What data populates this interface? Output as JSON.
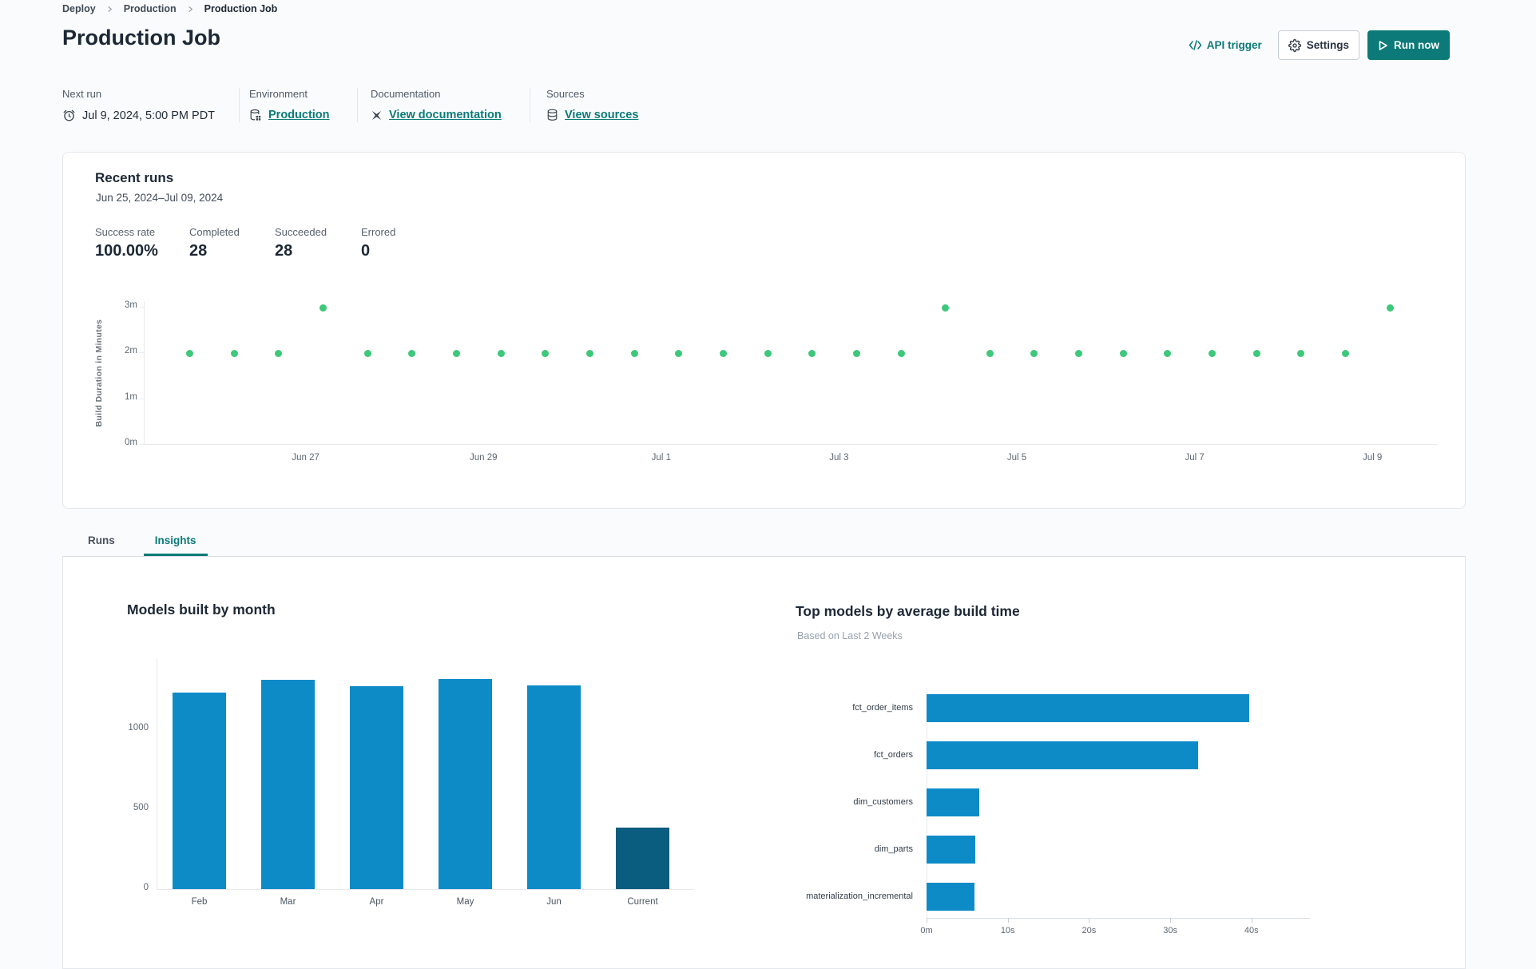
{
  "breadcrumb": {
    "items": [
      {
        "label": "Deploy"
      },
      {
        "label": "Production"
      },
      {
        "label": "Production Job"
      }
    ]
  },
  "header": {
    "title": "Production Job",
    "actions": {
      "api_trigger": "API trigger",
      "settings": "Settings",
      "run_now": "Run now"
    }
  },
  "meta": {
    "next_run": {
      "label": "Next run",
      "value": "Jul 9, 2024, 5:00 PM PDT"
    },
    "environment": {
      "label": "Environment",
      "value": "Production"
    },
    "documentation": {
      "label": "Documentation",
      "value": "View documentation"
    },
    "sources": {
      "label": "Sources",
      "value": "View sources"
    }
  },
  "recent_runs": {
    "title": "Recent runs",
    "date_range": "Jun 25, 2024–Jul 09, 2024",
    "stats": [
      {
        "label": "Success rate",
        "value": "100.00%"
      },
      {
        "label": "Completed",
        "value": "28"
      },
      {
        "label": "Succeeded",
        "value": "28"
      },
      {
        "label": "Errored",
        "value": "0"
      }
    ]
  },
  "tabs": [
    {
      "label": "Runs",
      "active": false
    },
    {
      "label": "Insights",
      "active": true
    }
  ],
  "colors": {
    "accent_teal": "#0b7a78",
    "scatter_green": "#3dc87a",
    "bar_blue": "#0d8bc7",
    "bar_dark_blue": "#0a5d7e"
  },
  "chart_data": [
    {
      "type": "scatter",
      "name": "build-duration-by-run",
      "ylabel": "Build Duration in Minutes",
      "point_color": "#3dc87a",
      "yticks": [
        {
          "label": "0m",
          "minutes": 0
        },
        {
          "label": "1m",
          "minutes": 1
        },
        {
          "label": "2m",
          "minutes": 2
        },
        {
          "label": "3m",
          "minutes": 3
        }
      ],
      "xticks": [
        {
          "label": "Jun 27",
          "frac": 0.1251
        },
        {
          "label": "Jun 29",
          "frac": 0.2625
        },
        {
          "label": "Jul 1",
          "frac": 0.3999
        },
        {
          "label": "Jul 3",
          "frac": 0.5373
        },
        {
          "label": "Jul 5",
          "frac": 0.6747
        },
        {
          "label": "Jul 7",
          "frac": 0.8121
        },
        {
          "label": "Jul 9",
          "frac": 0.9495
        }
      ],
      "point_start_frac": 0.0356,
      "point_step_frac": 0.03435,
      "points_minutes": [
        1.97,
        1.97,
        1.97,
        2.97,
        1.97,
        1.97,
        1.97,
        1.97,
        1.97,
        1.97,
        1.97,
        1.97,
        1.97,
        1.97,
        1.97,
        1.97,
        1.97,
        2.97,
        1.97,
        1.97,
        1.97,
        1.97,
        1.97,
        1.97,
        1.97,
        1.97,
        1.97,
        2.97
      ],
      "ylim_minutes": [
        0,
        3.1
      ]
    },
    {
      "type": "bar",
      "title": "Models built by month",
      "categories": [
        "Feb",
        "Mar",
        "Apr",
        "May",
        "Jun",
        "Current"
      ],
      "values": [
        1230,
        1310,
        1270,
        1315,
        1275,
        385
      ],
      "yticks": [
        0,
        500,
        1000
      ],
      "ylim": [
        0,
        1440
      ],
      "bar_colors": [
        "#0d8bc7",
        "#0d8bc7",
        "#0d8bc7",
        "#0d8bc7",
        "#0d8bc7",
        "#0a5d7e"
      ]
    },
    {
      "type": "hbar",
      "title": "Top models by average build time",
      "subtitle": "Based on Last 2 Weeks",
      "categories": [
        "fct_order_items",
        "fct_orders",
        "dim_customers",
        "dim_parts",
        "materialization_incremental"
      ],
      "values_seconds": [
        39.7,
        33.4,
        6.5,
        6.0,
        5.9
      ],
      "xticks": [
        {
          "label": "0m",
          "seconds": 0
        },
        {
          "label": "10s",
          "seconds": 10
        },
        {
          "label": "20s",
          "seconds": 20
        },
        {
          "label": "30s",
          "seconds": 30
        },
        {
          "label": "40s",
          "seconds": 40
        }
      ],
      "xlim_seconds": [
        0,
        45
      ],
      "bar_color": "#0d8bc7"
    }
  ]
}
